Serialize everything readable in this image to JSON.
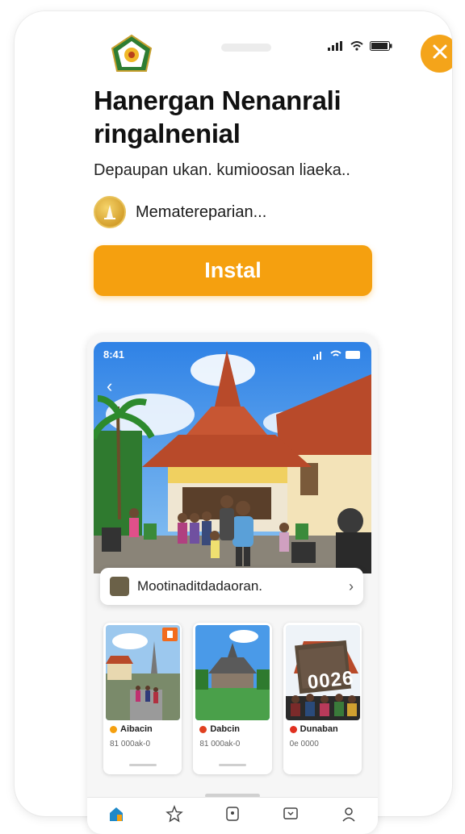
{
  "status_bar": {
    "icons": [
      "signal-icon",
      "wifi-icon",
      "battery-icon"
    ]
  },
  "header": {
    "logo_icon": "emblem-logo-icon",
    "close_icon": "close-icon"
  },
  "app": {
    "title": "Hanergan Nenanrali ringalnenial",
    "subtitle": "Depaupan ukan. kumioosan liaeka..",
    "developer": "Mematereparian...",
    "install_label": "Instal"
  },
  "preview": {
    "time": "8:41",
    "location_label": "Mootinaditdadaoran.",
    "cards": [
      {
        "title": "Aibacin",
        "meta": "81 000ak-0",
        "dot_color": "#f5a00f",
        "badge": true
      },
      {
        "title": "Dabcin",
        "meta": "81 000ak-0",
        "dot_color": "#e04020",
        "badge": false
      },
      {
        "title": "Dunaban",
        "meta": "0e 0000",
        "dot_color": "#e03020",
        "badge": false,
        "sign": "0026"
      }
    ],
    "tabs": [
      "home-icon",
      "explore-icon",
      "save-icon",
      "message-icon",
      "profile-icon"
    ]
  },
  "colors": {
    "accent": "#f5a00f",
    "close_bg": "#f4a41a"
  }
}
